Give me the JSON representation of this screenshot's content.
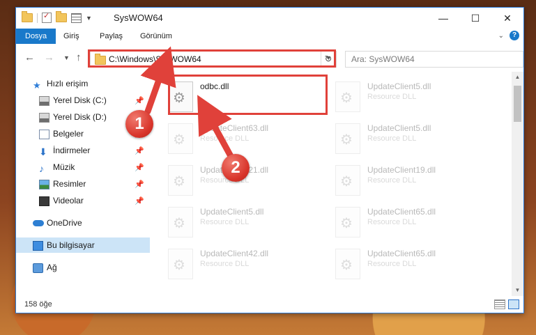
{
  "window": {
    "title": "SysWOW64",
    "controls": {
      "minimize": "—",
      "maximize": "☐",
      "close": "✕"
    }
  },
  "ribbon": {
    "tabs": [
      "Dosya",
      "Giriş",
      "Paylaş",
      "Görünüm"
    ]
  },
  "address_bar": {
    "path": "C:\\Windows\\SysWOW64",
    "search_placeholder": "Ara: SysWOW64"
  },
  "sidebar": {
    "quick_access": "Hızlı erişim",
    "items": [
      {
        "label": "Yerel Disk (C:)",
        "pinned": true
      },
      {
        "label": "Yerel Disk (D:)",
        "pinned": true
      },
      {
        "label": "Belgeler",
        "pinned": true
      },
      {
        "label": "İndirmeler",
        "pinned": true
      },
      {
        "label": "Müzik",
        "pinned": true
      },
      {
        "label": "Resimler",
        "pinned": true
      },
      {
        "label": "Videolar",
        "pinned": true
      }
    ],
    "onedrive": "OneDrive",
    "this_pc": "Bu bilgisayar",
    "network": "Ağ"
  },
  "files": [
    {
      "name": "odbc.dll",
      "type": "",
      "highlighted": true
    },
    {
      "name": "UpdateClient5.dll",
      "type": "Resource DLL"
    },
    {
      "name": "UpdateClient63.dll",
      "type": "Resource DLL"
    },
    {
      "name": "UpdateClient5.dll",
      "type": "Resource DLL"
    },
    {
      "name": "UpdateClient21.dll",
      "type": "Resource DLL"
    },
    {
      "name": "UpdateClient19.dll",
      "type": "Resource DLL"
    },
    {
      "name": "UpdateClient5.dll",
      "type": "Resource DLL"
    },
    {
      "name": "UpdateClient65.dll",
      "type": "Resource DLL"
    },
    {
      "name": "UpdateClient42.dll",
      "type": "Resource DLL"
    },
    {
      "name": "UpdateClient65.dll",
      "type": "Resource DLL"
    }
  ],
  "status": {
    "item_count": "158 öğe"
  },
  "callouts": [
    "1",
    "2"
  ],
  "colors": {
    "accent": "#1979ca",
    "highlight": "#e0413a",
    "selected": "#cce4f7"
  }
}
